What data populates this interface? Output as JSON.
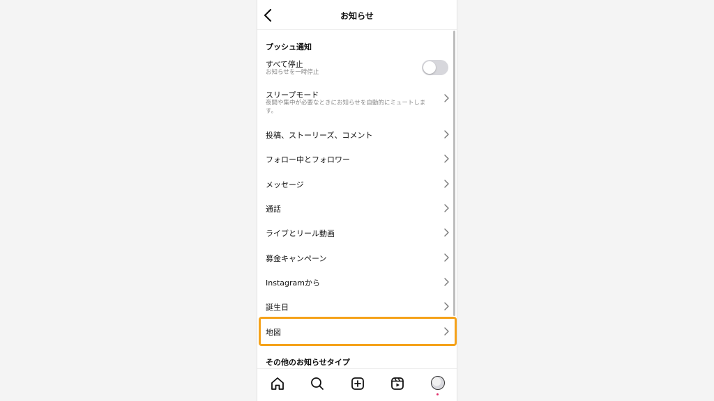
{
  "header": {
    "title": "お知らせ"
  },
  "push_section": {
    "title": "プッシュ通知"
  },
  "pause_all": {
    "label": "すべて停止",
    "sub": "お知らせを一時停止",
    "enabled": false
  },
  "sleep_mode": {
    "label": "スリープモード",
    "sub": "夜間や集中が必要なときにお知らせを自動的にミュートします。"
  },
  "items": [
    {
      "label": "投稿、ストーリーズ、コメント"
    },
    {
      "label": "フォロー中とフォロワー"
    },
    {
      "label": "メッセージ"
    },
    {
      "label": "通話"
    },
    {
      "label": "ライブとリール動画"
    },
    {
      "label": "募金キャンペーン"
    },
    {
      "label": "Instagramから"
    },
    {
      "label": "誕生日"
    },
    {
      "label": "地図"
    }
  ],
  "other_section": {
    "title": "その他のお知らせタイプ"
  },
  "colors": {
    "highlight": "#f5a21a",
    "toggle_off": "#d7d7dc",
    "badge": "#e1306c"
  },
  "nav_icons": [
    "home-icon",
    "search-icon",
    "create-icon",
    "reels-icon",
    "profile-avatar"
  ]
}
